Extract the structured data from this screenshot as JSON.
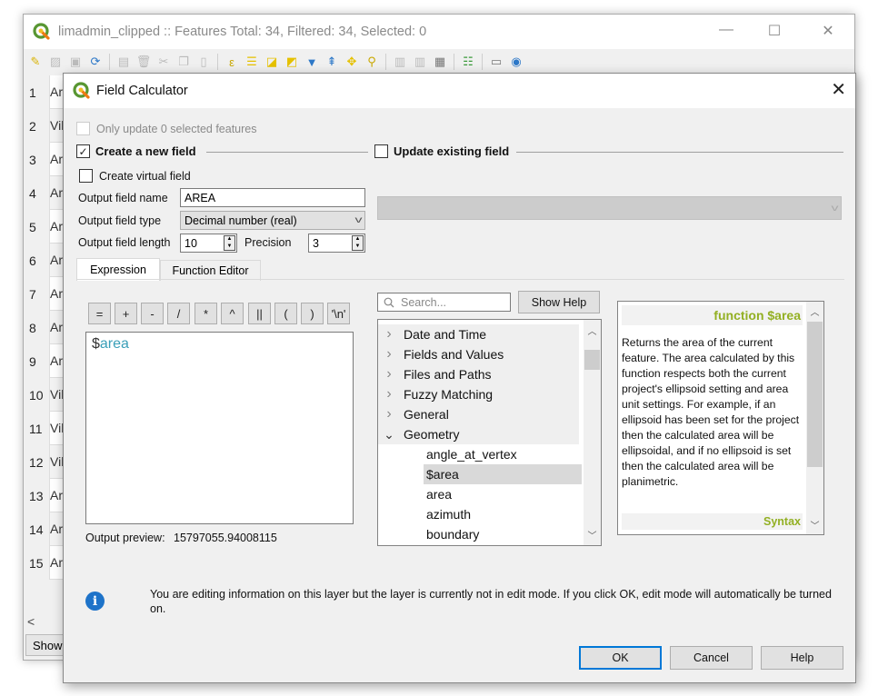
{
  "background_window": {
    "title": "limadmin_clipped :: Features Total: 34, Filtered: 34, Selected: 0",
    "controls": {
      "minimize": "—",
      "maximize": "☐",
      "close": "✕"
    },
    "toolbar_icons": [
      "toggle-edit-icon",
      "toggle-multi-edit-icon",
      "save-edits-icon",
      "reload-icon",
      "|",
      "add-feature-icon",
      "delete-feature-icon",
      "cut-icon",
      "copy-icon",
      "paste-icon",
      "|",
      "select-by-expression-icon",
      "select-all-icon",
      "invert-selection-icon",
      "deselect-all-icon",
      "filter-select-icon",
      "move-selection-top-icon",
      "pan-to-selection-icon",
      "zoom-to-selection-icon",
      "|",
      "new-field-icon",
      "delete-field-icon",
      "field-calculator-icon",
      "|",
      "conditional-formatting-icon",
      "|",
      "dock-table-icon",
      "actions-icon"
    ],
    "rows": [
      {
        "num": "1",
        "cell": "Arro"
      },
      {
        "num": "2",
        "cell": "Ville"
      },
      {
        "num": "3",
        "cell": "Arro"
      },
      {
        "num": "4",
        "cell": "Arro"
      },
      {
        "num": "5",
        "cell": "Arro"
      },
      {
        "num": "6",
        "cell": "Arro"
      },
      {
        "num": "7",
        "cell": "Arro"
      },
      {
        "num": "8",
        "cell": "Arro"
      },
      {
        "num": "9",
        "cell": "Arro"
      },
      {
        "num": "10",
        "cell": "Ville"
      },
      {
        "num": "11",
        "cell": "Ville"
      },
      {
        "num": "12",
        "cell": "Ville"
      },
      {
        "num": "13",
        "cell": "Arro"
      },
      {
        "num": "14",
        "cell": "Arro"
      },
      {
        "num": "15",
        "cell": "Arro"
      }
    ],
    "scroll_left": "<",
    "show_button_label": "Show All Features"
  },
  "dialog": {
    "title": "Field Calculator",
    "close": "✕",
    "only_update_selected": {
      "label": "Only update 0 selected features",
      "checked": false,
      "enabled": false
    },
    "create_new_field": {
      "label": "Create a new field",
      "checked": true
    },
    "update_existing_field": {
      "label": "Update existing field",
      "checked": false,
      "selected_value": ""
    },
    "create_virtual_field": {
      "label": "Create virtual field",
      "checked": false
    },
    "output_field_name": {
      "label": "Output field name",
      "value": "AREA"
    },
    "output_field_type": {
      "label": "Output field type",
      "value": "Decimal number (real)"
    },
    "output_field_length": {
      "label": "Output field length",
      "value": "10"
    },
    "precision": {
      "label": "Precision",
      "value": "3"
    },
    "tabs": [
      {
        "label": "Expression",
        "active": true
      },
      {
        "label": "Function Editor",
        "active": false
      }
    ],
    "operators": [
      "=",
      "+",
      "-",
      "/",
      "*",
      "^",
      "||",
      "(",
      ")",
      "'\\n'"
    ],
    "expression": {
      "dollar": "$",
      "fn": "area"
    },
    "output_preview": {
      "label": "Output preview:",
      "value": "15797055.94008115"
    },
    "search": {
      "placeholder": "Search..."
    },
    "show_help_label": "Show Help",
    "tree": {
      "groups": [
        {
          "label": "Date and Time",
          "expanded": false
        },
        {
          "label": "Fields and Values",
          "expanded": false
        },
        {
          "label": "Files and Paths",
          "expanded": false
        },
        {
          "label": "Fuzzy Matching",
          "expanded": false
        },
        {
          "label": "General",
          "expanded": false
        },
        {
          "label": "Geometry",
          "expanded": true
        }
      ],
      "children": [
        {
          "label": "angle_at_vertex",
          "selected": false
        },
        {
          "label": "$area",
          "selected": true
        },
        {
          "label": "area",
          "selected": false
        },
        {
          "label": "azimuth",
          "selected": false
        },
        {
          "label": "boundary",
          "selected": false
        }
      ]
    },
    "help": {
      "heading": "function $area",
      "body": "Returns the area of the current feature. The area calculated by this function respects both the current project's ellipsoid setting and area unit settings. For example, if an ellipsoid has been set for the project then the calculated area will be ellipsoidal, and if no ellipsoid is set then the calculated area will be planimetric.",
      "footer": "Syntax"
    },
    "info_message": "You are editing information on this layer but the layer is currently not in edit mode. If you click OK, edit mode will automatically be turned on.",
    "buttons": {
      "ok": "OK",
      "cancel": "Cancel",
      "help": "Help"
    }
  },
  "colors": {
    "qgis_green": "#589632",
    "help_heading": "#93b023",
    "expression_function": "#3a9fb8",
    "default_button_border": "#0078d7",
    "info_icon": "#1e73c9"
  }
}
